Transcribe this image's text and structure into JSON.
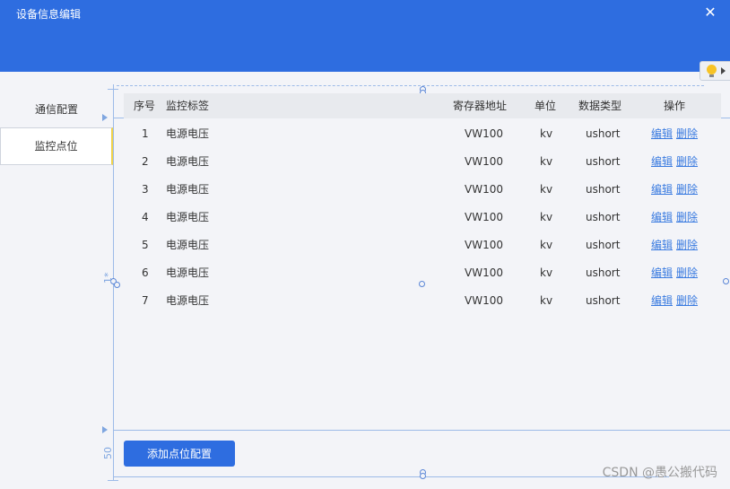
{
  "window": {
    "title": "设备信息编辑",
    "close_glyph": "✕"
  },
  "sidebar": {
    "tabs": [
      {
        "label": "通信配置"
      },
      {
        "label": "监控点位"
      }
    ]
  },
  "table": {
    "columns": {
      "index": "序号",
      "label": "监控标签",
      "address": "寄存器地址",
      "unit": "单位",
      "type": "数据类型",
      "actions": "操作"
    },
    "rows": [
      {
        "index": "1",
        "label": "电源电压",
        "address": "VW100",
        "unit": "kv",
        "type": "ushort",
        "edit": "编辑",
        "delete": "删除"
      },
      {
        "index": "2",
        "label": "电源电压",
        "address": "VW100",
        "unit": "kv",
        "type": "ushort",
        "edit": "编辑",
        "delete": "删除"
      },
      {
        "index": "3",
        "label": "电源电压",
        "address": "VW100",
        "unit": "kv",
        "type": "ushort",
        "edit": "编辑",
        "delete": "删除"
      },
      {
        "index": "4",
        "label": "电源电压",
        "address": "VW100",
        "unit": "kv",
        "type": "ushort",
        "edit": "编辑",
        "delete": "删除"
      },
      {
        "index": "5",
        "label": "电源电压",
        "address": "VW100",
        "unit": "kv",
        "type": "ushort",
        "edit": "编辑",
        "delete": "删除"
      },
      {
        "index": "6",
        "label": "电源电压",
        "address": "VW100",
        "unit": "kv",
        "type": "ushort",
        "edit": "编辑",
        "delete": "删除"
      },
      {
        "index": "7",
        "label": "电源电压",
        "address": "VW100",
        "unit": "kv",
        "type": "ushort",
        "edit": "编辑",
        "delete": "删除"
      }
    ]
  },
  "footer": {
    "add_label": "添加点位配置"
  },
  "rulers": {
    "top_value": "1*",
    "bottom_value": "50"
  },
  "watermark": "CSDN @愚公搬代码",
  "colors": {
    "primary": "#2e6de0",
    "link": "#3a7be0",
    "guide": "#9dbbe8"
  }
}
